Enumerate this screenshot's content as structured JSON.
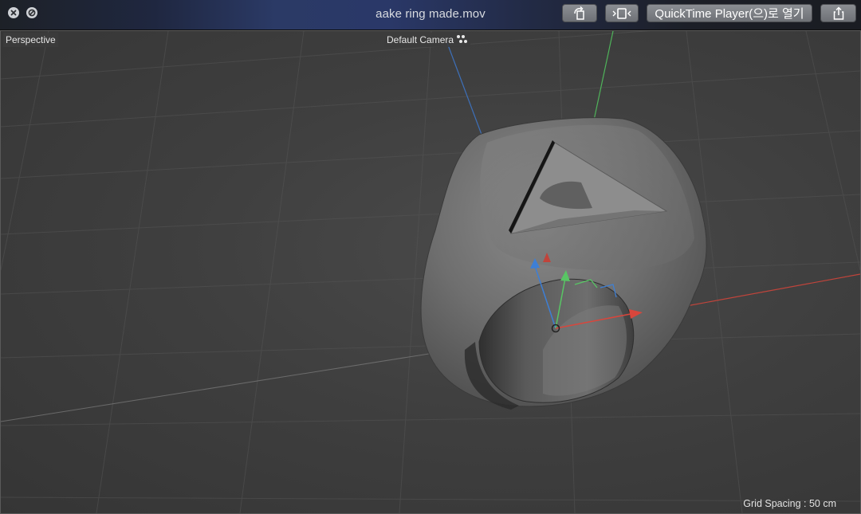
{
  "window": {
    "title": "aake ring made.mov",
    "buttons": {
      "rotate_icon": "rotate-icon",
      "trim_icon": "trim-icon",
      "open_with_label": "QuickTime Player(으)로 열기",
      "share_icon": "share-icon"
    }
  },
  "viewport": {
    "view_label": "Perspective",
    "camera_label": "Default Camera",
    "grid_spacing_label": "Grid Spacing : 50 cm"
  },
  "colors": {
    "axis_x": "#d9463c",
    "axis_y": "#58c564",
    "axis_z": "#3d7fd6",
    "ring": "#777777"
  }
}
